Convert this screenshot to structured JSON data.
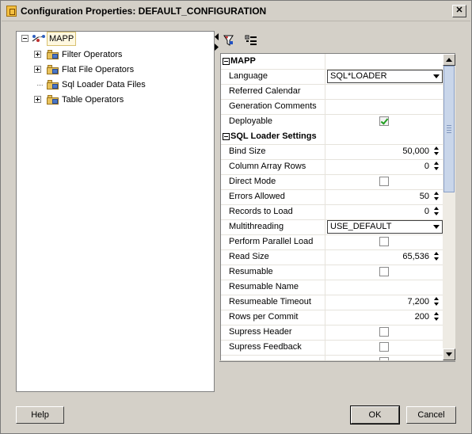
{
  "window": {
    "title": "Configuration Properties: DEFAULT_CONFIGURATION"
  },
  "icons": {
    "title": "config-app-icon",
    "close": "close-icon",
    "expand": "expand-icon",
    "collapse": "collapse-icon",
    "folder": "folder-icon",
    "mapping": "mapping-icon",
    "filter": "filter-icon",
    "categorize": "categorize-icon"
  },
  "tree": {
    "root": "MAPP",
    "items": [
      {
        "label": "Filter Operators",
        "expandable": true
      },
      {
        "label": "Flat File Operators",
        "expandable": true
      },
      {
        "label": "Sql Loader Data Files",
        "expandable": false
      },
      {
        "label": "Table Operators",
        "expandable": true
      }
    ]
  },
  "properties": {
    "sections": [
      {
        "title": "MAPP",
        "rows": [
          {
            "name": "Language",
            "type": "dropdown",
            "value": "SQL*LOADER"
          },
          {
            "name": "Referred Calendar",
            "type": "text",
            "value": ""
          },
          {
            "name": "Generation Comments",
            "type": "text",
            "value": ""
          },
          {
            "name": "Deployable",
            "type": "checkbox",
            "checked": true
          }
        ]
      },
      {
        "title": "SQL Loader Settings",
        "rows": [
          {
            "name": "Bind Size",
            "type": "number",
            "value": "50,000"
          },
          {
            "name": "Column Array Rows",
            "type": "number",
            "value": "0"
          },
          {
            "name": "Direct Mode",
            "type": "checkbox",
            "checked": false
          },
          {
            "name": "Errors Allowed",
            "type": "number",
            "value": "50"
          },
          {
            "name": "Records to Load",
            "type": "number",
            "value": "0"
          },
          {
            "name": "Multithreading",
            "type": "dropdown",
            "value": "USE_DEFAULT"
          },
          {
            "name": "Perform Parallel Load",
            "type": "checkbox",
            "checked": false
          },
          {
            "name": "Read Size",
            "type": "number",
            "value": "65,536"
          },
          {
            "name": "Resumable",
            "type": "checkbox",
            "checked": false
          },
          {
            "name": "Resumable Name",
            "type": "text",
            "value": ""
          },
          {
            "name": "Resumeable Timeout",
            "type": "number",
            "value": "7,200"
          },
          {
            "name": "Rows per Commit",
            "type": "number",
            "value": "200"
          },
          {
            "name": "Supress Header",
            "type": "checkbox",
            "checked": false
          },
          {
            "name": "Supress Feedback",
            "type": "checkbox",
            "checked": false
          },
          {
            "name": "",
            "type": "checkbox",
            "checked": false
          }
        ]
      }
    ]
  },
  "buttons": {
    "help": "Help",
    "ok": "OK",
    "cancel": "Cancel"
  }
}
